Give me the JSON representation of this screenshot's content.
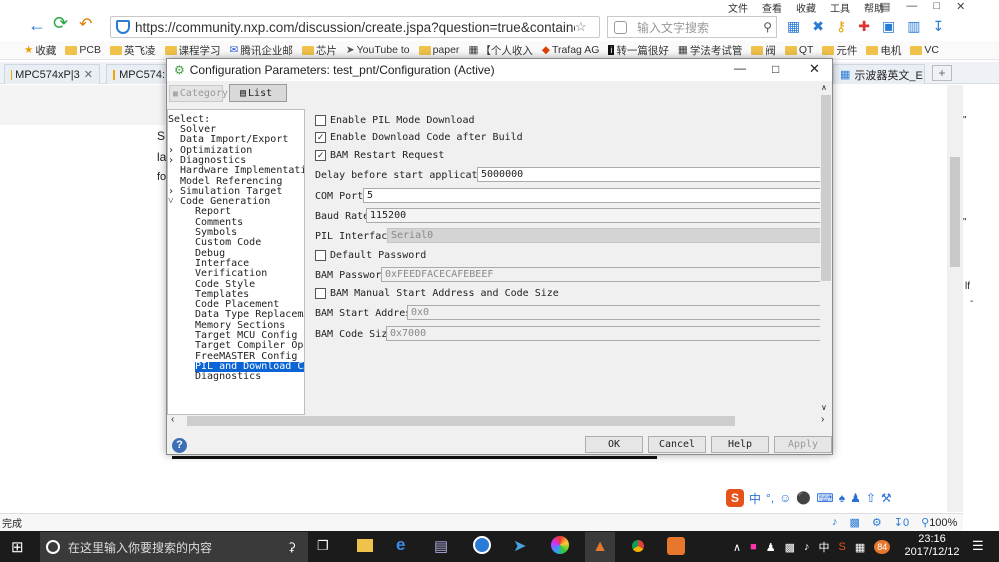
{
  "browser": {
    "menu": [
      "文件",
      "查看",
      "收藏",
      "工具",
      "帮助"
    ],
    "url": "https://community.nxp.com/discussion/create.jspa?question=true&containerT",
    "search_placeholder": "输入文字搜索",
    "bookmarks": [
      "收藏",
      "PCB",
      "英飞凌",
      "课程学习",
      "腾讯企业邮",
      "芯片",
      "YouTube to",
      "paper",
      "【个人收入",
      "Trafag AG",
      "转一篇很好",
      "学法考试管",
      "阀",
      "QT",
      "元件",
      "电机",
      "VC"
    ],
    "tabs": [
      "MPC574xP|3",
      "MPC574:",
      "示波器英文_E"
    ],
    "status_left": "完成",
    "zoom": "100%",
    "download_count": "0"
  },
  "page": {
    "left_letters": [
      "S",
      "la",
      "fo"
    ],
    "right_marks": [
      "\"",
      "\"",
      "lf",
      "-"
    ]
  },
  "dialog": {
    "title": "Configuration Parameters: test_pnt/Configuration (Active)",
    "toolbar": {
      "category": "Category",
      "list": "List"
    },
    "select_label": "Select:",
    "tree": [
      {
        "label": "Solver",
        "level": 0,
        "arrow": ""
      },
      {
        "label": "Data Import/Export",
        "level": 0,
        "arrow": ""
      },
      {
        "label": "Optimization",
        "level": 0,
        "arrow": ">"
      },
      {
        "label": "Diagnostics",
        "level": 0,
        "arrow": ">"
      },
      {
        "label": "Hardware Implementation",
        "level": 0,
        "arrow": ""
      },
      {
        "label": "Model Referencing",
        "level": 0,
        "arrow": ""
      },
      {
        "label": "Simulation Target",
        "level": 0,
        "arrow": ">"
      },
      {
        "label": "Code Generation",
        "level": 0,
        "arrow": "v"
      },
      {
        "label": "Report",
        "level": 1,
        "arrow": ""
      },
      {
        "label": "Comments",
        "level": 1,
        "arrow": ""
      },
      {
        "label": "Symbols",
        "level": 1,
        "arrow": ""
      },
      {
        "label": "Custom Code",
        "level": 1,
        "arrow": ""
      },
      {
        "label": "Debug",
        "level": 1,
        "arrow": ""
      },
      {
        "label": "Interface",
        "level": 1,
        "arrow": ""
      },
      {
        "label": "Verification",
        "level": 1,
        "arrow": ""
      },
      {
        "label": "Code Style",
        "level": 1,
        "arrow": ""
      },
      {
        "label": "Templates",
        "level": 1,
        "arrow": ""
      },
      {
        "label": "Code Placement",
        "level": 1,
        "arrow": ""
      },
      {
        "label": "Data Type Replacem…",
        "level": 1,
        "arrow": ""
      },
      {
        "label": "Memory Sections",
        "level": 1,
        "arrow": ""
      },
      {
        "label": "Target MCU Config",
        "level": 1,
        "arrow": ""
      },
      {
        "label": "Target Compiler Opts",
        "level": 1,
        "arrow": ""
      },
      {
        "label": "FreeMASTER Config",
        "level": 1,
        "arrow": ""
      },
      {
        "label": "PIL and Download C…",
        "level": 1,
        "arrow": "",
        "selected": true
      },
      {
        "label": "Diagnostics",
        "level": 1,
        "arrow": ""
      }
    ],
    "params": {
      "enable_pil": {
        "label": "Enable PIL Mode Download",
        "checked": false
      },
      "enable_download": {
        "label": "Enable Download Code after Build",
        "checked": true
      },
      "bam_restart": {
        "label": "BAM Restart Request",
        "checked": true
      },
      "delay": {
        "label": "Delay before start application",
        "value": "5000000"
      },
      "com_port": {
        "label": "COM Port",
        "value": "5"
      },
      "baud": {
        "label": "Baud Rate",
        "value": "115200"
      },
      "pil_iface": {
        "label": "PIL Interface",
        "value": "Serial0"
      },
      "default_pw": {
        "label": "Default Password",
        "checked": false
      },
      "bam_pw": {
        "label": "BAM Password",
        "value": "0xFEEDFACECAFEBEEF"
      },
      "bam_manual": {
        "label": "BAM Manual Start Address and Code Size",
        "checked": false
      },
      "bam_start": {
        "label": "BAM Start Address",
        "value": "0x0"
      },
      "bam_size": {
        "label": "BAM Code Size",
        "value": "0x7000"
      }
    },
    "buttons": {
      "ok": "OK",
      "cancel": "Cancel",
      "help": "Help",
      "apply": "Apply"
    }
  },
  "taskbar": {
    "search_placeholder": "在这里输入你要搜索的内容",
    "time": "23:16",
    "date": "2017/12/12",
    "ime": "中",
    "badge": "84"
  },
  "ime_bar": [
    "中",
    "°,"
  ]
}
